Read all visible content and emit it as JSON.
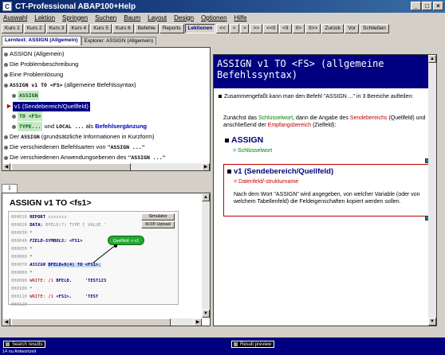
{
  "window": {
    "title": "CT-Professional ABAP100+Help",
    "controls": [
      "_",
      "□",
      "×"
    ]
  },
  "menu": [
    "Auswahl",
    "Lektion",
    "Springen",
    "Suchen",
    "Baum",
    "Layout",
    "Design",
    "Optionen",
    "Hilfe"
  ],
  "toolbar": {
    "buttons": [
      "Kurs 1",
      "Kurs 2",
      "Kurs 3",
      "Kurs 4",
      "Kurs 5",
      "Kurs 6",
      "Befehle",
      "Reports"
    ],
    "active": "Lektionen",
    "nav": [
      "<<",
      "<",
      ">",
      ">>",
      "<<II",
      "<II",
      "II>",
      "II>>"
    ],
    "right_buttons": [
      "Zurück",
      "Vor",
      "Schließen"
    ]
  },
  "tabs": [
    "Lerntext: ASSIGN (Allgemein)",
    "Explorer: ASSIGN (Allgemein)"
  ],
  "tree": {
    "items": [
      "ASSIGN (Allgemein)",
      "Die Problembeschreibung",
      "Eine Problemlösung",
      "ASSIGN v1 TO <FS>",
      "(allgemeine Befehlssyntax)",
      "ASSIGN",
      "v1 (Sendebereich/Quellfeld)",
      "TO <FS>",
      "TYPE...",
      "und",
      "LOCAL ...",
      "als",
      "Befehlsergänzung",
      "Der",
      "ASSIGN",
      "(grundsätzliche Informationen in Kurzform)",
      "Die verschiedenen Befehlsarten von",
      "\"ASSIGN ...\"",
      "Die verschiedenen Anwendungsebenen des",
      "\"ASSIGN ...\""
    ]
  },
  "preview": {
    "tab": "1",
    "title": "ASSIGN v1 TO <fs1>",
    "buttons": [
      "Simulator",
      "R/3® Upload"
    ],
    "balloon": "Quellfeld -> v1",
    "code": [
      {
        "n": "000010",
        "t": "REPORT ",
        "k": "zzzzzzz.",
        "c": "k"
      },
      {
        "n": "000020",
        "t": "DATA: ",
        "k": "BFELD(7) TYPE C VALUE '",
        "c": "k"
      },
      {
        "n": "000030",
        "t": "*",
        "k": "",
        "c": "g"
      },
      {
        "n": "000040",
        "t": "FIELD-SYMBOLS: ",
        "k": "<FS1>",
        "c": "i"
      },
      {
        "n": "000050",
        "t": "*",
        "k": "",
        "c": "g"
      },
      {
        "n": "000060",
        "t": "*",
        "k": "",
        "c": "g"
      },
      {
        "n": "000070",
        "t": "ASSIGN ",
        "k": "BFELD+0(4) TO <FS1>.",
        "c": "i"
      },
      {
        "n": "000080",
        "t": "*",
        "k": "",
        "c": "g"
      },
      {
        "n": "000090",
        "t": "WRITE: /1 ",
        "k": "BFELD.     'TEST123",
        "c": "p"
      },
      {
        "n": "000100",
        "t": "*",
        "k": "",
        "c": "g"
      },
      {
        "n": "000110",
        "t": "WRITE: /1 ",
        "k": "<FS1>.     'TEST",
        "c": "p"
      },
      {
        "n": "000120",
        "t": "",
        "k": "",
        "c": "g"
      }
    ]
  },
  "doc": {
    "header": "ASSIGN v1 TO <FS> (allgemeine Befehlssyntax)",
    "p1": "Zusammengefaßt kann man den Befehl \"ASSIGN ...\" in 3 Bereiche aufteilen:",
    "p2_a": "Zunächst das ",
    "p2_b": "Schlüsselwort",
    "p2_c": ", dann die Angabe des ",
    "p2_d": "Sendebereichs",
    "p2_e": "(Quellfeld) und anschließend der ",
    "p2_f": "Empfangsbereich",
    "p2_g": " (Zielfeld):",
    "h_assign": "ASSIGN",
    "assign_sub": "= Schlüsselwort",
    "h_v1": "v1 (Sendebereich/Quellfeld)",
    "v1_sub": "= Datenfeld/-strukturname",
    "p3": "Nach dem Wort \"ASSIGN\" wird angegeben, von welcher Variable (oder von welchem Tabellenfeld) die Feldeigenschaften kopiert werden sollen."
  },
  "status": {
    "search": "Search results",
    "preview": "Result preview",
    "text": "14 nu Antwortzeit"
  }
}
